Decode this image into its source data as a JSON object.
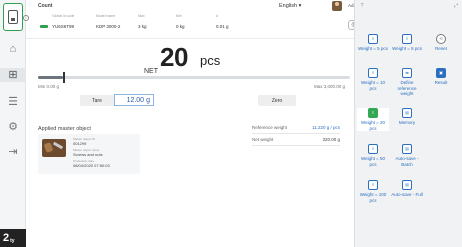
{
  "app": {
    "title": "Count",
    "language": "English",
    "user": "Admin, Default"
  },
  "nav": {
    "bottom_label": "2",
    "bottom_sub": "ty"
  },
  "info": [
    {
      "label": "Global id code",
      "value": "YU6S6T99"
    },
    {
      "label": "Model name",
      "value": "KDP 3000-2"
    },
    {
      "label": "Max",
      "value": "3 kg"
    },
    {
      "label": "Min",
      "value": "0 kg"
    },
    {
      "label": "d",
      "value": "0.01 g"
    }
  ],
  "reading": {
    "prefix": "NET",
    "value": "20",
    "unit": "pcs"
  },
  "range": {
    "min_label": "Min 0.00 g",
    "max_label": "Max 3,000.00 g",
    "fill_fraction": 0.08
  },
  "tare": {
    "button": "Tare",
    "value": "12.00",
    "unit": "g"
  },
  "zero": {
    "button": "Zero"
  },
  "master": {
    "title": "Applied master object",
    "fields": [
      {
        "label": "Master object ID",
        "value": "001299"
      },
      {
        "label": "Master object name",
        "value": "Screws and nuts"
      },
      {
        "label": "Production date",
        "value": "08/04/2020 07:50:03"
      }
    ]
  },
  "stats": {
    "reference_label": "Reference weight",
    "reference_value": "11.220 g / pcs",
    "net_label": "Net weight",
    "net_value": "320.00 g"
  },
  "panel": {
    "tiles": [
      {
        "label": "Weight = 5 pcs",
        "icon": "scale-5-icon"
      },
      {
        "label": "Weight = 5 pcs",
        "icon": "scale-5b-icon"
      },
      {
        "label": "Reset",
        "icon": "reset-icon"
      },
      {
        "label": "Weight = 10 pcs",
        "icon": "scale-10-icon"
      },
      {
        "label": "Define reference weight",
        "icon": "define-icon"
      },
      {
        "label": "Result",
        "icon": "result-icon"
      },
      {
        "label": "Weight = 20 pcs",
        "icon": "scale-20-icon"
      },
      {
        "label": "Memory",
        "icon": "memory-icon"
      },
      {
        "label": "Weight = 50 pcs",
        "icon": "scale-50-icon"
      },
      {
        "label": "Auto-save - Batch",
        "icon": "autosave-batch-icon"
      },
      {
        "label": "Weight = 100 pcs",
        "icon": "scale-100-icon"
      },
      {
        "label": "Auto-save - Full",
        "icon": "autosave-full-icon"
      }
    ],
    "icon_glyphs": [
      "≡",
      "≡",
      "⟲",
      "≡",
      "⇆",
      "▣",
      "≡",
      "▤",
      "≡",
      "▤",
      "≡",
      "▤"
    ]
  },
  "colors": {
    "accent": "#2b6fc1",
    "active": "#32a852",
    "panel": "#f1f2f3"
  }
}
